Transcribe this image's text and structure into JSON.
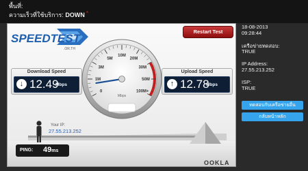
{
  "top": {
    "line1": "พื้นที่:",
    "line2_label": "ความเร็วที่ใช้บริการ:",
    "line2_status": "DOWN",
    "warn_mark": "*"
  },
  "logo": {
    "text": "SPEEDTEST",
    "sub": ".OR.TH"
  },
  "restart_label": "Restart Test",
  "download": {
    "label": "Download Speed",
    "value": "12.49",
    "unit": "Mbps"
  },
  "upload": {
    "label": "Upload Speed",
    "value": "12.78",
    "unit": "Mbps"
  },
  "gauge": {
    "ticks": [
      "0",
      "1M",
      "3M",
      "5M",
      "10M",
      "20M",
      "30M",
      "50M",
      "100M+"
    ],
    "unit": "Mbps",
    "needle_value_mbps": 0.7
  },
  "ip": {
    "label": "Your IP:",
    "value": "27.55.213.252"
  },
  "ping": {
    "label": "PING:",
    "value": "49",
    "unit": "ms"
  },
  "brand": "OOKLA",
  "side": {
    "date": "18-08-2013",
    "time": "09:28:44",
    "network_label": "เครือข่ายทดสอบ:",
    "network_value": "TRUE",
    "ip_label": "IP Address:",
    "ip_value": "27.55.213.252",
    "isp_label": "ISP:",
    "isp_value": "TRUE",
    "btn1": "ทดสอบกับเครือข่ายอื่น",
    "btn2": "กลับหน้าหลัก"
  },
  "colors": {
    "accent_blue": "#35a4ec",
    "restart_red": "#b22222",
    "display_navy": "#0e1e35",
    "ip_blue": "#2a5db0"
  }
}
